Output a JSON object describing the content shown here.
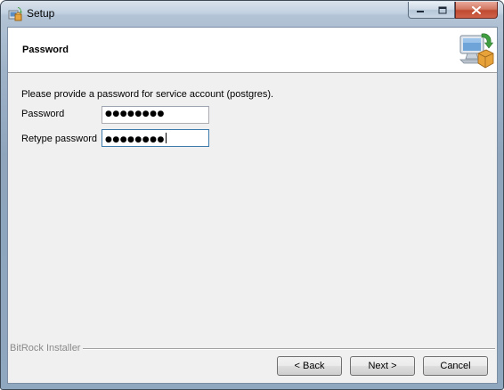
{
  "window": {
    "title": "Setup",
    "controls": {
      "minimize_icon": "minimize-icon",
      "maximize_icon": "maximize-icon",
      "close_icon": "close-icon"
    }
  },
  "header": {
    "title": "Password",
    "icon": "installer-computer-icon"
  },
  "form": {
    "intro": "Please provide a password for service account (postgres).",
    "password_label": "Password",
    "password_value": "●●●●●●●●",
    "retype_label": "Retype password",
    "retype_value": "●●●●●●●●"
  },
  "footer": {
    "brand": "BitRock Installer",
    "back_label": "< Back",
    "next_label": "Next >",
    "cancel_label": "Cancel"
  },
  "colors": {
    "title_bar": "#a8bdd3",
    "close_button": "#c9533a",
    "client_background": "#f0f0f0",
    "focus_border": "#3d7bad"
  }
}
